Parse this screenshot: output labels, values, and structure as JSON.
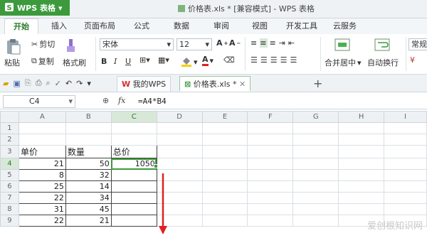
{
  "app": {
    "name": "WPS 表格",
    "window_title": "价格表.xls * [兼容模式] - WPS 表格"
  },
  "ribbon_tabs": [
    "开始",
    "插入",
    "页面布局",
    "公式",
    "数据",
    "审阅",
    "视图",
    "开发工具",
    "云服务"
  ],
  "ribbon": {
    "cut": "剪切",
    "paste": "粘贴",
    "copy": "复制",
    "format_painter": "格式刷",
    "font_name": "宋体",
    "font_size": "12",
    "merge_center": "合并居中",
    "wrap_text": "自动换行",
    "number_format": "常规"
  },
  "doc_tabs": [
    {
      "label": "我的WPS"
    },
    {
      "label": "价格表.xls *"
    }
  ],
  "formula_bar": {
    "cell_ref": "C4",
    "fx": "fx",
    "formula": "=A4*B4"
  },
  "columns": [
    "A",
    "B",
    "C",
    "D",
    "E",
    "F",
    "G",
    "H",
    "I"
  ],
  "rows": [
    {
      "n": "1",
      "cells": [
        "",
        "",
        ""
      ]
    },
    {
      "n": "2",
      "cells": [
        "",
        "",
        ""
      ]
    },
    {
      "n": "3",
      "cells": [
        "单价",
        "数量",
        "总价"
      ]
    },
    {
      "n": "4",
      "cells": [
        "21",
        "50",
        "1050"
      ]
    },
    {
      "n": "5",
      "cells": [
        "8",
        "32",
        ""
      ]
    },
    {
      "n": "6",
      "cells": [
        "25",
        "14",
        ""
      ]
    },
    {
      "n": "7",
      "cells": [
        "22",
        "34",
        ""
      ]
    },
    {
      "n": "8",
      "cells": [
        "31",
        "45",
        ""
      ]
    },
    {
      "n": "9",
      "cells": [
        "22",
        "21",
        ""
      ]
    }
  ],
  "watermark": "爱创根知识网",
  "colors": {
    "accent": "#3c9a3c",
    "arrow": "#e02020"
  }
}
